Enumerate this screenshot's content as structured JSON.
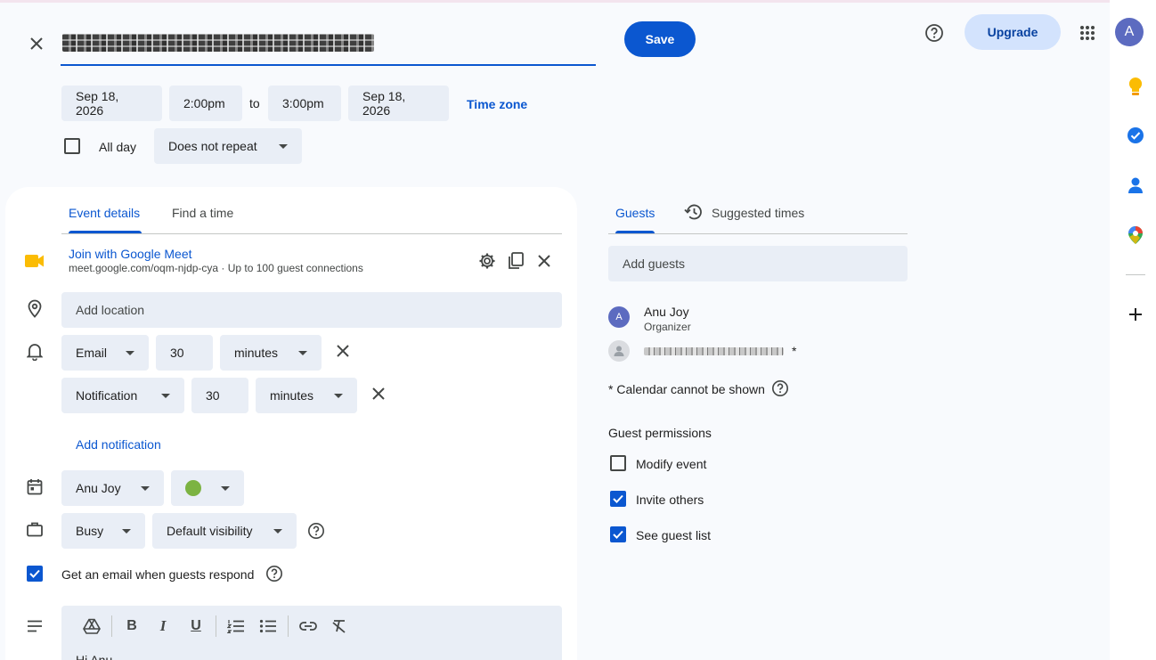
{
  "header": {
    "save_label": "Save",
    "upgrade_label": "Upgrade",
    "avatar_letter": "A"
  },
  "datetime": {
    "start_date": "Sep 18, 2026",
    "start_time": "2:00pm",
    "to_label": "to",
    "end_time": "3:00pm",
    "end_date": "Sep 18, 2026",
    "timezone_label": "Time zone",
    "allday_label": "All day",
    "repeat_value": "Does not repeat"
  },
  "details": {
    "tabs": [
      "Event details",
      "Find a time"
    ],
    "meet_title": "Join with Google Meet",
    "meet_subtitle": "meet.google.com/oqm-njdp-cya · Up to 100 guest connections",
    "location_placeholder": "Add location",
    "notifications": [
      {
        "type": "Email",
        "amount": "30",
        "unit": "minutes"
      },
      {
        "type": "Notification",
        "amount": "30",
        "unit": "minutes"
      }
    ],
    "add_notification_label": "Add notification",
    "calendar_owner": "Anu Joy",
    "event_color": "#7cb342",
    "busy_value": "Busy",
    "visibility_value": "Default visibility",
    "email_guests_label": "Get an email when guests respond",
    "description_text": "Hi Anu"
  },
  "guests": {
    "tabs": [
      "Guests",
      "Suggested times"
    ],
    "add_placeholder": "Add guests",
    "organizer_name": "Anu Joy",
    "organizer_role": "Organizer",
    "organizer_initial": "A",
    "second_guest_marker": "*",
    "calendar_note": "* Calendar cannot be shown",
    "permissions_heading": "Guest permissions",
    "permissions": [
      {
        "label": "Modify event",
        "checked": false
      },
      {
        "label": "Invite others",
        "checked": true
      },
      {
        "label": "See guest list",
        "checked": true
      }
    ]
  },
  "colors": {
    "accent": "#0b57d0",
    "field_bg": "#e9eef6",
    "page_bg": "#f8fafd"
  }
}
